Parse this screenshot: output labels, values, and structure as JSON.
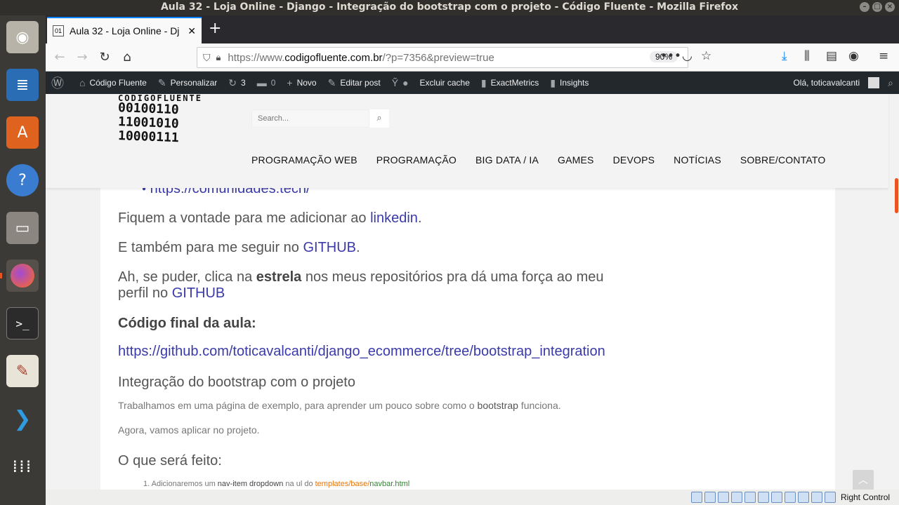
{
  "window": {
    "title": "Aula 32 - Loja Online - Django - Integração do bootstrap com o projeto - Código Fluente - Mozilla Firefox"
  },
  "dock": {
    "items": [
      "rhythmbox-icon",
      "writer-icon",
      "software-center-icon",
      "help-icon",
      "files-icon",
      "firefox-icon",
      "terminal-icon",
      "text-editor-icon",
      "vscode-icon",
      "apps-grid-icon"
    ]
  },
  "browser": {
    "tab_title": "Aula 32 - Loja Online - Dj",
    "url_prefix": "https://www.",
    "url_host": "codigofluente.com.br",
    "url_path": "/?p=7356&preview=true",
    "zoom": "90%"
  },
  "wp_admin_bar": {
    "site_name": "Código Fluente",
    "customize": "Personalizar",
    "updates_count": "3",
    "comments_count": "0",
    "new": "Novo",
    "edit_post": "Editar post",
    "clear_cache": "Excluir cache",
    "exactmetrics": "ExactMetrics",
    "insights": "Insights",
    "greeting": "Olá, toticavalcanti"
  },
  "site": {
    "logo_top": "CÓDIGOFLUENTE",
    "logo_bin1": "00100110",
    "logo_bin2": "11001010",
    "logo_bin3": "10000111",
    "search_placeholder": "Search...",
    "nav": [
      "PROGRAMAÇÃO WEB",
      "PROGRAMAÇÃO",
      "BIG DATA / IA",
      "GAMES",
      "DEVOPS",
      "NOTÍCIAS",
      "SOBRE/CONTATO"
    ]
  },
  "article": {
    "bullet_link": "https://comunidades.tech/",
    "p1_text": "Fiquem a vontade para me adicionar ao ",
    "p1_link": "linkedin",
    "p1_end": ".",
    "p2_text": "E também para me seguir no ",
    "p2_link": "GITHUB",
    "p2_end": ".",
    "p3_a": "Ah, se puder, clica na ",
    "p3_bold": "estrela",
    "p3_b": " nos meus repositórios pra dá uma força ao meu",
    "p3_c": "perfil no ",
    "p3_link": "GITHUB",
    "h_final": "Código final da aula:",
    "final_link": "https://github.com/toticavalcanti/django_ecommerce/tree/bootstrap_integration",
    "h_integration": "Integração do bootstrap com o projeto",
    "s1_a": "Trabalhamos em uma página de exemplo, para aprender um pouco sobre como o ",
    "s1_bold": "bootstrap",
    "s1_b": " funciona.",
    "s2": "Agora, vamos aplicar no projeto.",
    "h_what": "O que será feito:",
    "li1_num": "1.",
    "li1_a": "Adicionaremos um ",
    "li1_bold": "nav-item dropdown",
    "li1_b": " na ul do ",
    "li1_path": "templates/base/",
    "li1_file": "navbar.html"
  },
  "vbox": {
    "host_key": "Right Control"
  },
  "colors": {
    "link": "#3a3aa8",
    "accent": "#e95420",
    "path_orange": "#e8760c",
    "path_green": "#2a8a2a"
  }
}
